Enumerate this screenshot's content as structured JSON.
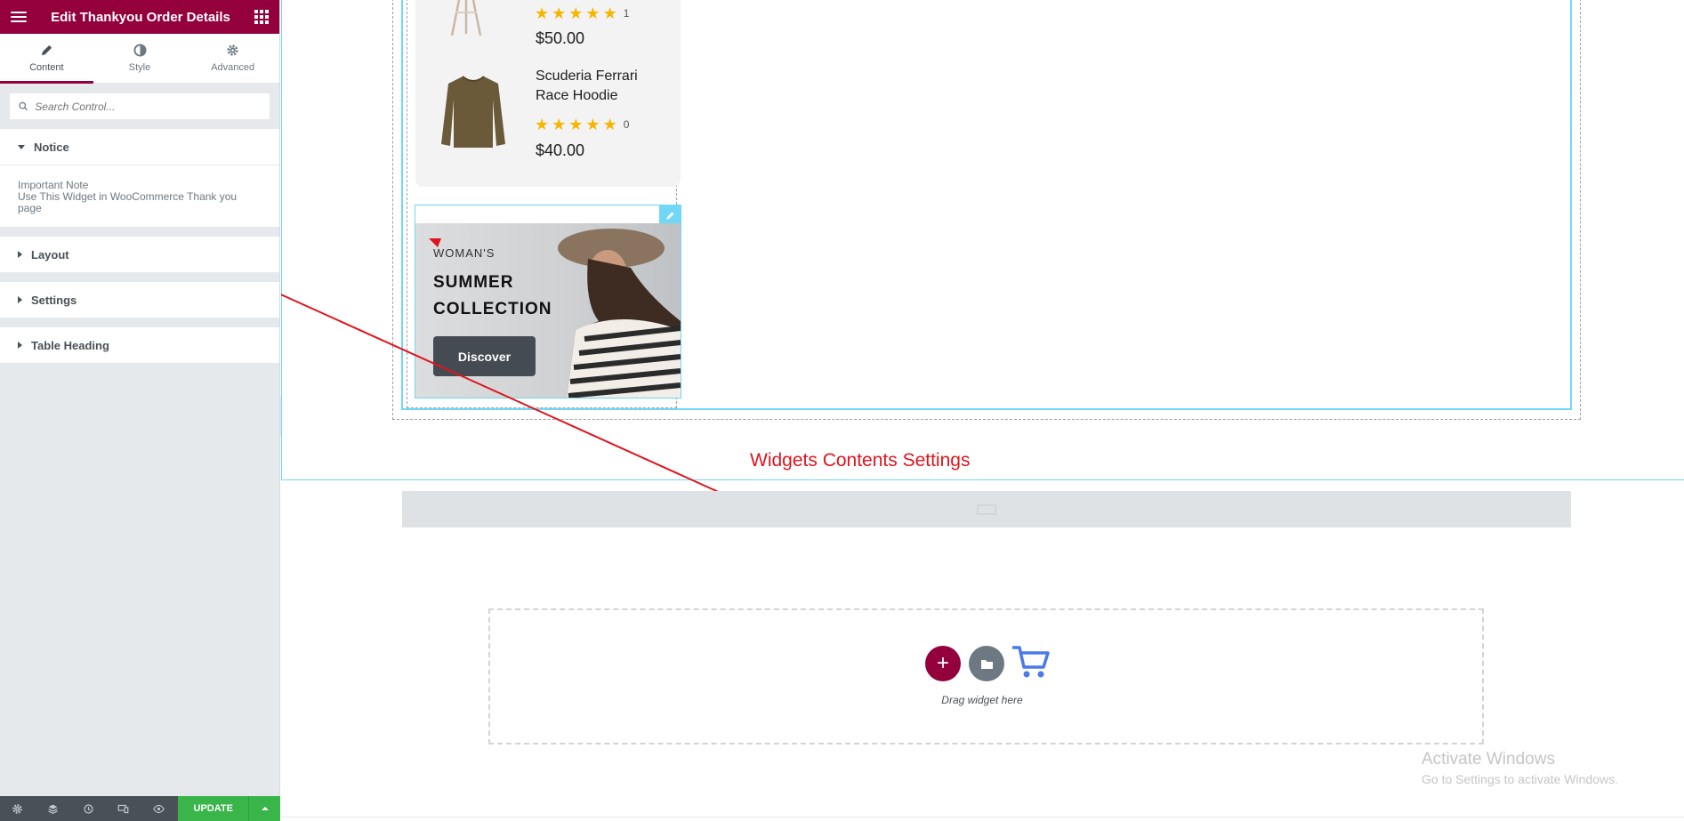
{
  "panel": {
    "title": "Edit Thankyou Order Details",
    "tabs": [
      {
        "label": "Content",
        "icon": "pencil-icon"
      },
      {
        "label": "Style",
        "icon": "contrast-icon"
      },
      {
        "label": "Advanced",
        "icon": "gear-icon"
      }
    ],
    "search_placeholder": "Search Control...",
    "sections": [
      {
        "label": "Notice",
        "expanded": true
      },
      {
        "label": "Layout",
        "expanded": false
      },
      {
        "label": "Settings",
        "expanded": false
      },
      {
        "label": "Table Heading",
        "expanded": false
      }
    ],
    "notice": {
      "heading": "Important Note",
      "text": "Use This Widget in WooCommerce Thank you page"
    },
    "footer": {
      "update_label": "UPDATE"
    }
  },
  "products": [
    {
      "rating_count": "1",
      "price": "$50.00"
    },
    {
      "name": "Scuderia Ferrari Race Hoodie",
      "rating_count": "0",
      "price": "$40.00"
    }
  ],
  "banner": {
    "eyebrow": "WOMAN'S",
    "title_line1": "SUMMER",
    "title_line2": "COLLECTION",
    "button_label": "Discover"
  },
  "annotation": {
    "text": "Widgets Contents Settings",
    "color": "#e0141e"
  },
  "dropzone": {
    "hint": "Drag widget here"
  },
  "watermark": {
    "title": "Activate Windows",
    "subtitle": "Go to Settings to activate Windows."
  },
  "colors": {
    "brand": "#93003c",
    "update": "#39b54a",
    "selection": "#71d7f7"
  }
}
